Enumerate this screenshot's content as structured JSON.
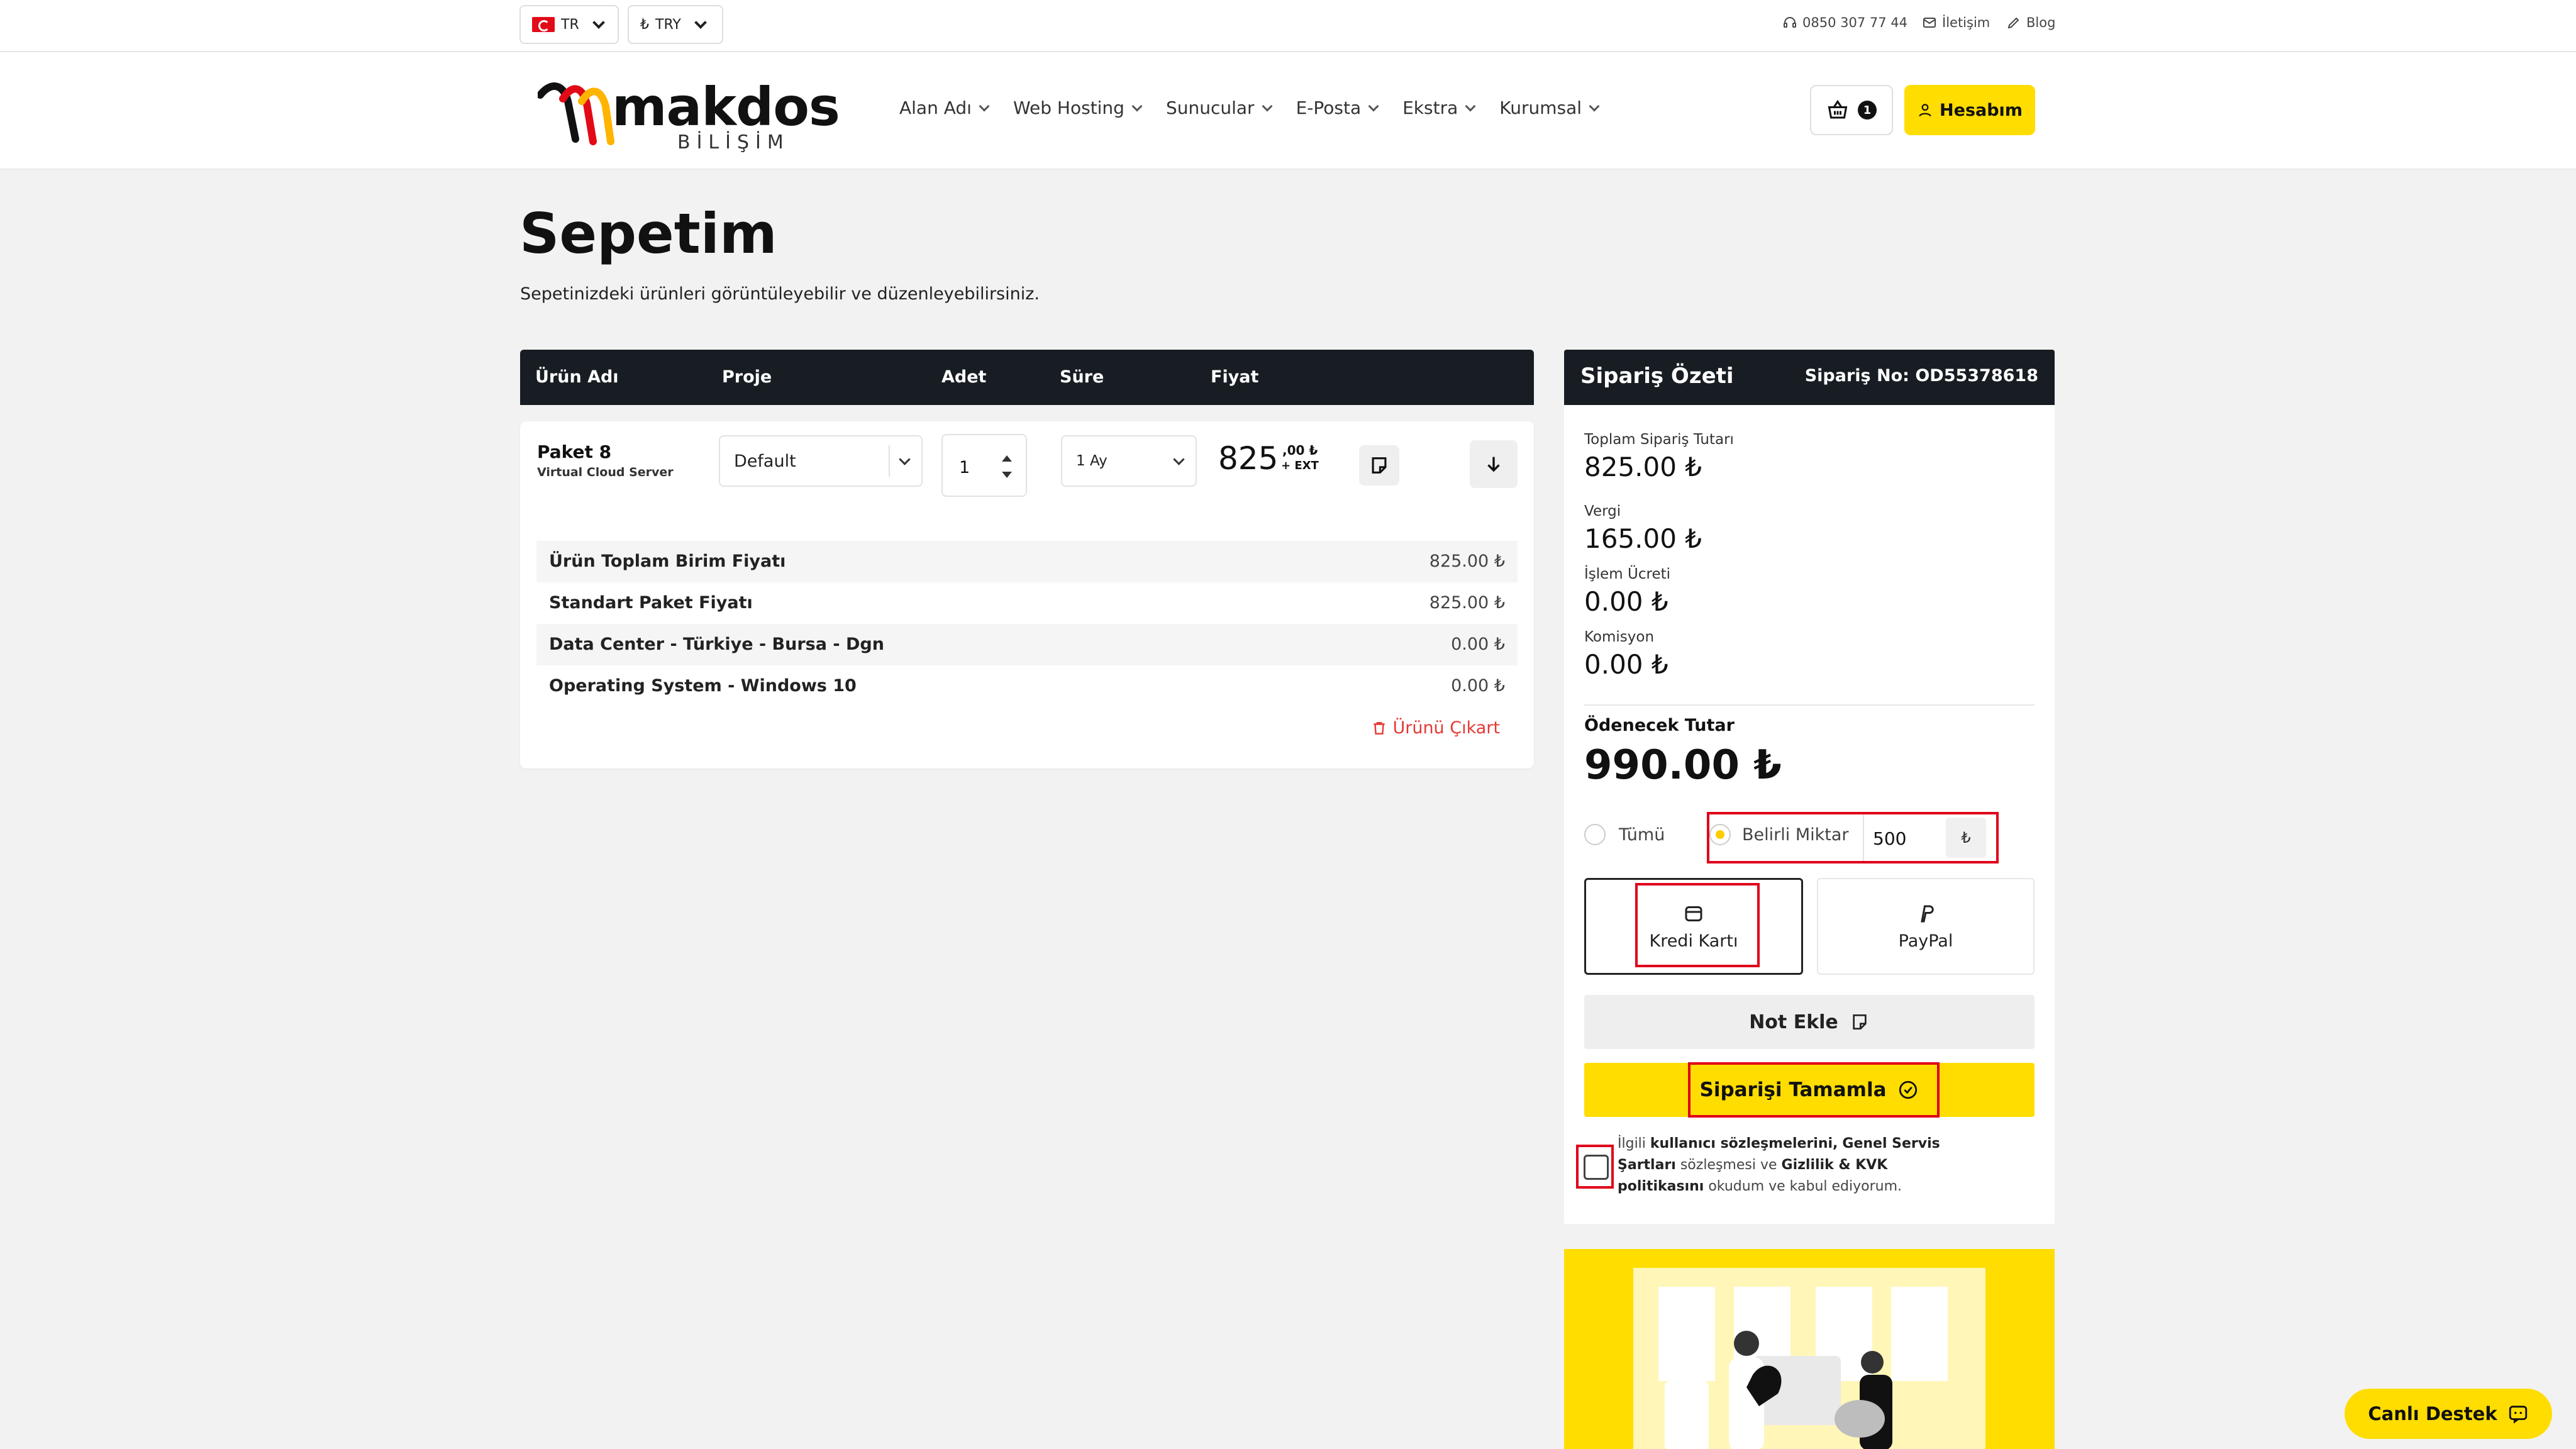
{
  "topbar": {
    "language": "TR",
    "currency": "TRY",
    "phone": "0850 307 77 44",
    "contact": "İletişim",
    "blog": "Blog"
  },
  "header": {
    "logo_text": "makdos",
    "logo_sub": "BİLİŞİM",
    "nav": [
      "Alan Adı",
      "Web Hosting",
      "Sunucular",
      "E-Posta",
      "Ekstra",
      "Kurumsal"
    ],
    "cart_count": "1",
    "account_label": "Hesabım"
  },
  "page": {
    "title": "Sepetim",
    "subtitle": "Sepetinizdeki ürünleri görüntüleyebilir ve düzenleyebilirsiniz."
  },
  "cart": {
    "columns": [
      "Ürün Adı",
      "Proje",
      "Adet",
      "Süre",
      "Fiyat"
    ],
    "item": {
      "name": "Paket 8",
      "type": "Virtual Cloud Server",
      "project": "Default",
      "quantity": "1",
      "period": "1 Ay",
      "price_main": "825",
      "price_decimal": ",00 ₺",
      "price_tax": "+ EXT"
    },
    "details": [
      {
        "label": "Ürün Toplam Birim Fiyatı",
        "value": "825.00 ₺"
      },
      {
        "label": "Standart Paket Fiyatı",
        "value": "825.00 ₺"
      },
      {
        "label": "Data Center - Türkiye - Bursa - Dgn",
        "value": "0.00 ₺"
      },
      {
        "label": "Operating System - Windows 10",
        "value": "0.00 ₺"
      }
    ],
    "remove_label": "Ürünü Çıkart"
  },
  "summary": {
    "title": "Sipariş Özeti",
    "order_no": "Sipariş No: OD55378618",
    "lines": [
      {
        "label": "Toplam Sipariş Tutarı",
        "value": "825.00 ₺"
      },
      {
        "label": "Vergi",
        "value": "165.00 ₺"
      },
      {
        "label": "İşlem Ücreti",
        "value": "0.00 ₺"
      },
      {
        "label": "Komisyon",
        "value": "0.00 ₺"
      }
    ],
    "total_label": "Ödenecek Tutar",
    "total_value": "990.00 ₺",
    "option_all": "Tümü",
    "option_specific": "Belirli Miktar",
    "specific_amount": "500",
    "amount_currency": "₺",
    "pay_card": "Kredi Kartı",
    "pay_paypal": "PayPal",
    "note_button": "Not Ekle",
    "complete_button": "Siparişi Tamamla",
    "agreement": {
      "prefix": "İlgili",
      "link1": "kullanıcı sözleşmelerini,",
      "link2": "Genel Servis Şartları",
      "middle": "sözleşmesi ve",
      "link3": "Gizlilik & KVK politikasını",
      "suffix": "okudum ve kabul ediyorum."
    }
  },
  "live_support": "Canlı Destek",
  "colors": {
    "accent": "#ffdd00",
    "dark": "#171d22",
    "danger": "#e53935",
    "highlight_box": "#e0001b"
  }
}
